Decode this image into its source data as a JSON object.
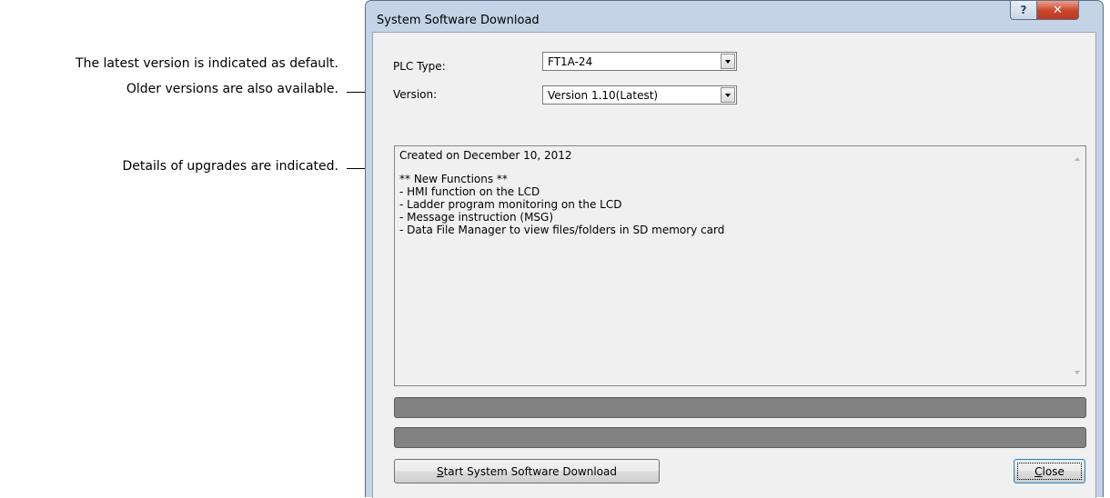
{
  "annotations": {
    "latest_default": "The latest version is indicated as default.",
    "older_versions": "Older versions are also available.",
    "details": "Details of upgrades are indicated."
  },
  "dialog": {
    "title": "System Software Download",
    "help_glyph": "?",
    "close_glyph": "✕",
    "plc_type_label": "PLC Type:",
    "plc_type_value": "FT1A-24",
    "version_label": "Version:",
    "version_value": "Version 1.10(Latest)",
    "details_lines": [
      "Created on December 10, 2012",
      "",
      "** New Functions **",
      "- HMI function on the LCD",
      "- Ladder program monitoring on the LCD",
      "- Message instruction (MSG)",
      "- Data File Manager to view files/folders in SD memory card"
    ],
    "start_button_mnemonic": "S",
    "start_button_rest": "tart System Software Download",
    "close_button_mnemonic": "C",
    "close_button_rest": "lose"
  }
}
